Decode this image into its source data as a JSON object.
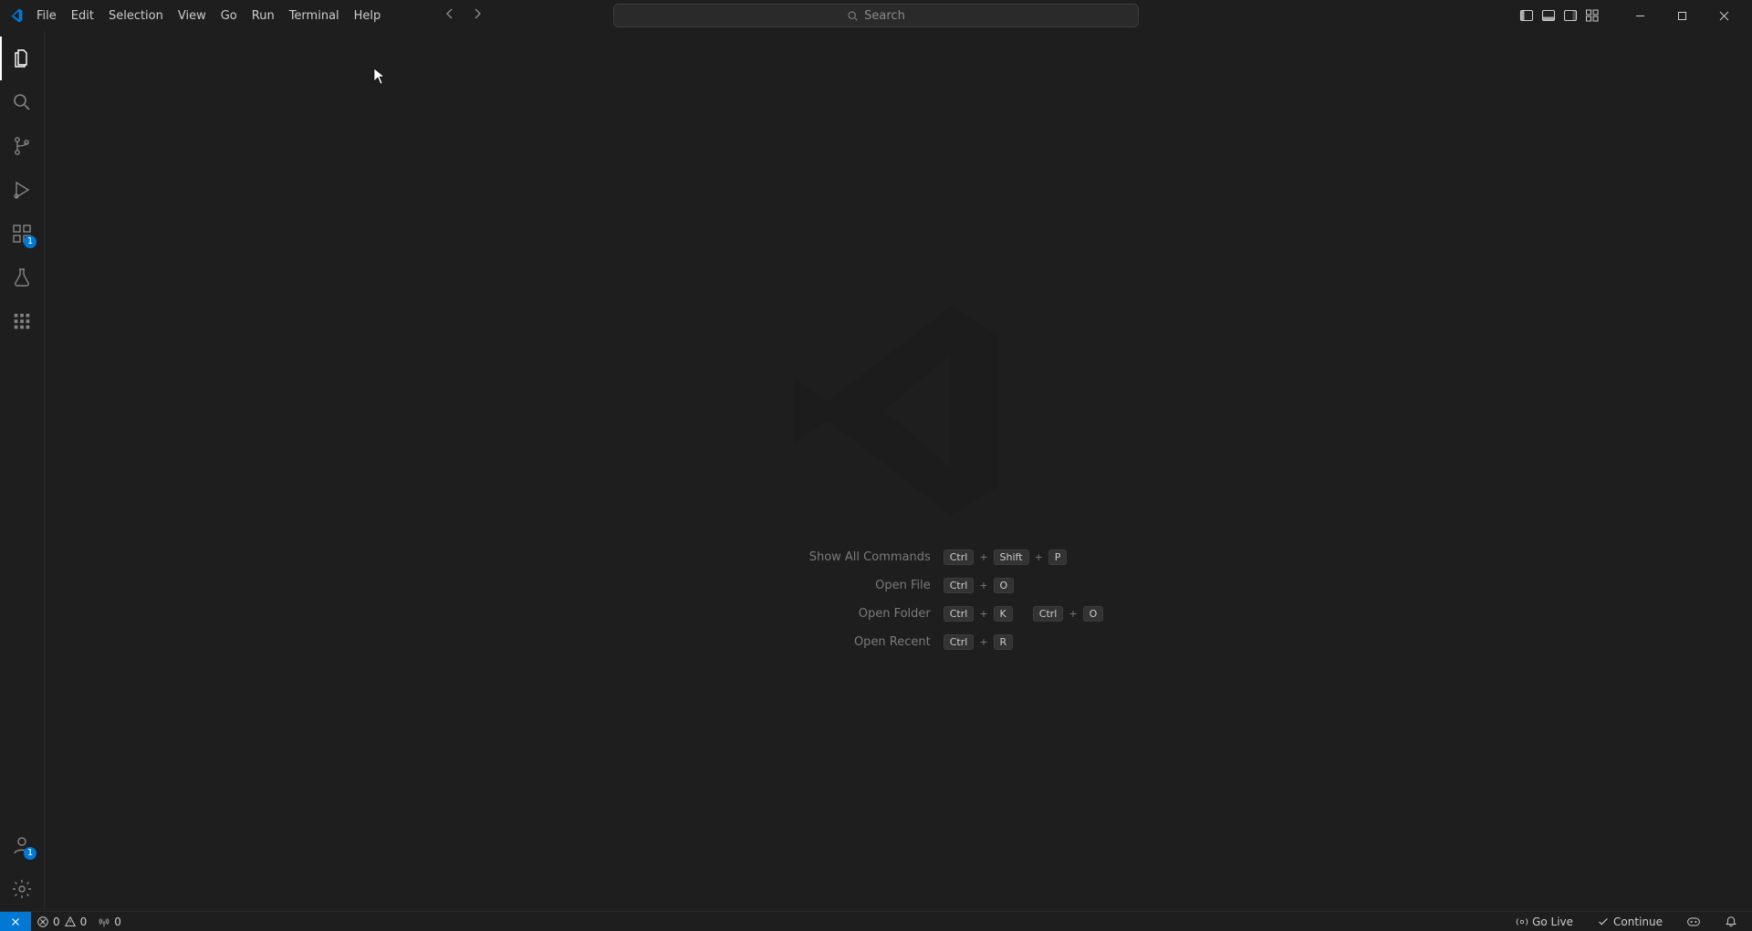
{
  "menu": [
    "File",
    "Edit",
    "Selection",
    "View",
    "Go",
    "Run",
    "Terminal",
    "Help"
  ],
  "search": {
    "placeholder": "Search"
  },
  "activity_badges": {
    "extensions": "1",
    "accounts": "1"
  },
  "hints": [
    {
      "label": "Show All Commands",
      "keys": [
        "Ctrl",
        "+",
        "Shift",
        "+",
        "P"
      ]
    },
    {
      "label": "Open File",
      "keys": [
        "Ctrl",
        "+",
        "O"
      ]
    },
    {
      "label": "Open Folder",
      "keys": [
        "Ctrl",
        "+",
        "K",
        "gap",
        "Ctrl",
        "+",
        "O"
      ]
    },
    {
      "label": "Open Recent",
      "keys": [
        "Ctrl",
        "+",
        "R"
      ]
    }
  ],
  "status": {
    "errors": "0",
    "warnings": "0",
    "ports": "0",
    "go_live": "Go Live",
    "continue": "Continue"
  }
}
